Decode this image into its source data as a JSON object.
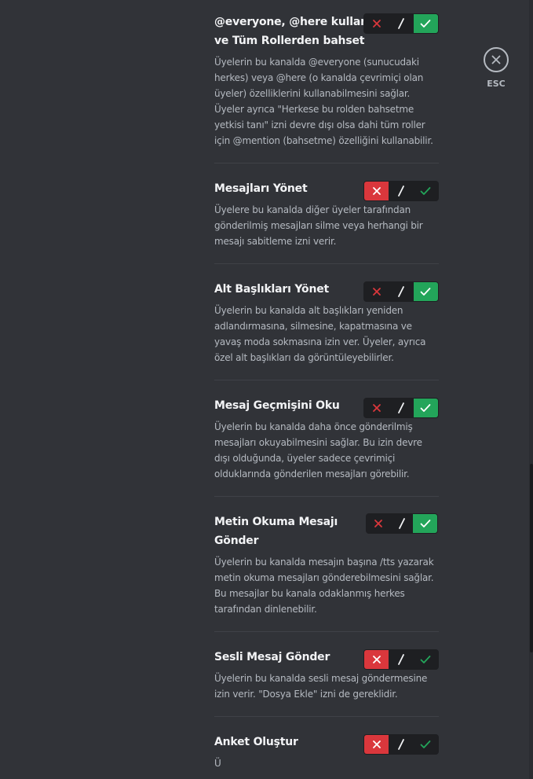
{
  "esc": {
    "label": "ESC"
  },
  "permissions": [
    {
      "title": "@everyone, @here kullan ve Tüm Rollerden bahset",
      "description": "Üyelerin bu kanalda @everyone (sunucudaki herkes) veya @here (o kanalda çevrimiçi olan üyeler) özelliklerini kullanabilmesini sağlar. Üyeler ayrıca \"Herkese bu rolden bahsetme yetkisi tanı\" izni devre dışı olsa dahi tüm roller için @mention (bahsetme) özelliğini kullanabilir.",
      "state": "allow"
    },
    {
      "title": "Mesajları Yönet",
      "description": "Üyelere bu kanalda diğer üyeler tarafından gönderilmiş mesajları silme veya herhangi bir mesajı sabitleme izni verir.",
      "state": "deny"
    },
    {
      "title": "Alt Başlıkları Yönet",
      "description": "Üyelerin bu kanalda alt başlıkları yeniden adlandırmasına, silmesine, kapatmasına ve yavaş moda sokmasına izin ver. Üyeler, ayrıca özel alt başlıkları da görüntüleyebilirler.",
      "state": "allow"
    },
    {
      "title": "Mesaj Geçmişini Oku",
      "description": "Üyelerin bu kanalda daha önce gönderilmiş mesajları okuyabilmesini sağlar. Bu izin devre dışı olduğunda, üyeler sadece çevrimiçi olduklarında gönderilen mesajları görebilir.",
      "state": "allow"
    },
    {
      "title": "Metin Okuma Mesajı Gönder",
      "description": "Üyelerin bu kanalda mesajın başına /tts yazarak metin okuma mesajları gönderebilmesini sağlar. Bu mesajlar bu kanala odaklanmış herkes tarafından dinlenebilir.",
      "state": "allow"
    },
    {
      "title": "Sesli Mesaj Gönder",
      "description": "Üyelerin bu kanalda sesli mesaj göndermesine izin verir. \"Dosya Ekle\" izni de gereklidir.",
      "state": "deny"
    },
    {
      "title": "Anket Oluştur",
      "description": "Ü",
      "state": "deny"
    }
  ]
}
